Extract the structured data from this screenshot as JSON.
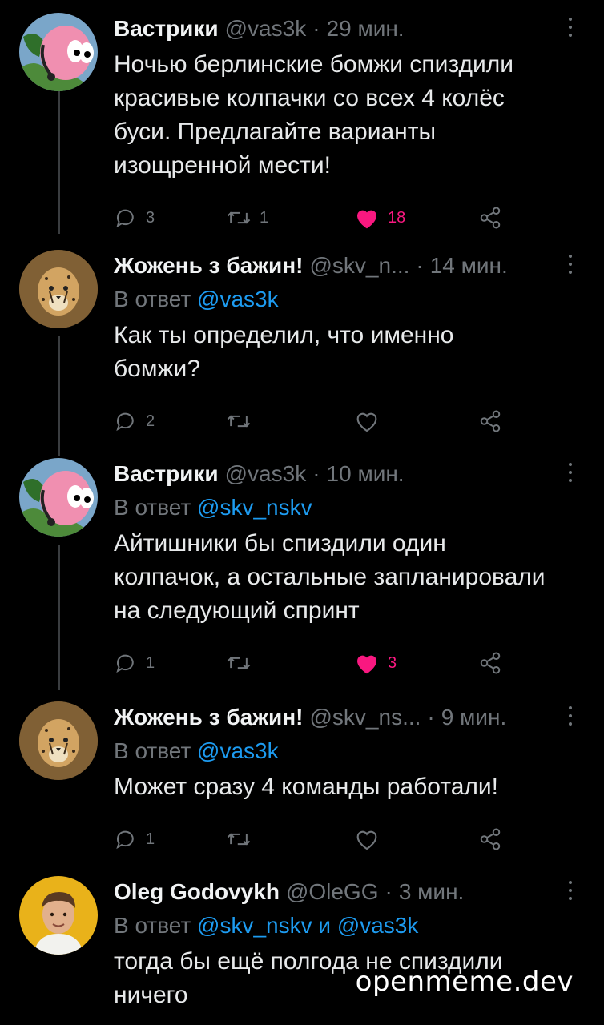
{
  "tweets": [
    {
      "name": "Вастрики",
      "handle": "@vas3k",
      "time": "29 мин.",
      "reply_prefix": "",
      "reply_mentions": "",
      "text_lines": [
        "Ночью берлинские бомжи спиздили",
        "красивые колпачки со всех 4 колёс",
        "буси. Предлагайте варианты",
        "изощренной мести!"
      ],
      "replies": "3",
      "retweets": "1",
      "likes": "18",
      "liked": true,
      "avatar_icon": "worm-avatar-icon"
    },
    {
      "name": "Жожень з бажин!",
      "handle": "@skv_n...",
      "time": "14 мин.",
      "reply_prefix": "В ответ",
      "reply_mentions": "@vas3k",
      "text_lines": [
        "Как ты определил, что именно",
        "бомжи?"
      ],
      "replies": "2",
      "retweets": "",
      "likes": "",
      "liked": false,
      "avatar_icon": "cheetah-avatar-icon"
    },
    {
      "name": "Вастрики",
      "handle": "@vas3k",
      "time": "10 мин.",
      "reply_prefix": "В ответ",
      "reply_mentions": "@skv_nskv",
      "text_lines": [
        "Айтишники бы спиздили один",
        "колпачок, а остальные запланировали",
        "на следующий спринт"
      ],
      "replies": "1",
      "retweets": "",
      "likes": "3",
      "liked": true,
      "avatar_icon": "worm-avatar-icon"
    },
    {
      "name": "Жожень з бажин!",
      "handle": "@skv_ns...",
      "time": "9 мин.",
      "reply_prefix": "В ответ",
      "reply_mentions": "@vas3k",
      "text_lines": [
        "Может сразу 4 команды работали!"
      ],
      "replies": "1",
      "retweets": "",
      "likes": "",
      "liked": false,
      "avatar_icon": "cheetah-avatar-icon"
    },
    {
      "name": "Oleg Godovykh",
      "handle": "@OleGG",
      "time": "3 мин.",
      "reply_prefix": "В ответ",
      "reply_mentions": "@skv_nskv и @vas3k",
      "text_lines": [
        "тогда бы ещё полгода не спиздили",
        "ничего"
      ],
      "replies": "",
      "retweets": "",
      "likes": "",
      "liked": false,
      "avatar_icon": "person-avatar-icon"
    }
  ],
  "watermark": "openmeme.dev",
  "colors": {
    "background": "#000000",
    "text": "#e7e9ea",
    "muted": "#71767b",
    "link": "#1d9bf0",
    "like": "#f91880",
    "thread_line": "#3a3d40"
  }
}
